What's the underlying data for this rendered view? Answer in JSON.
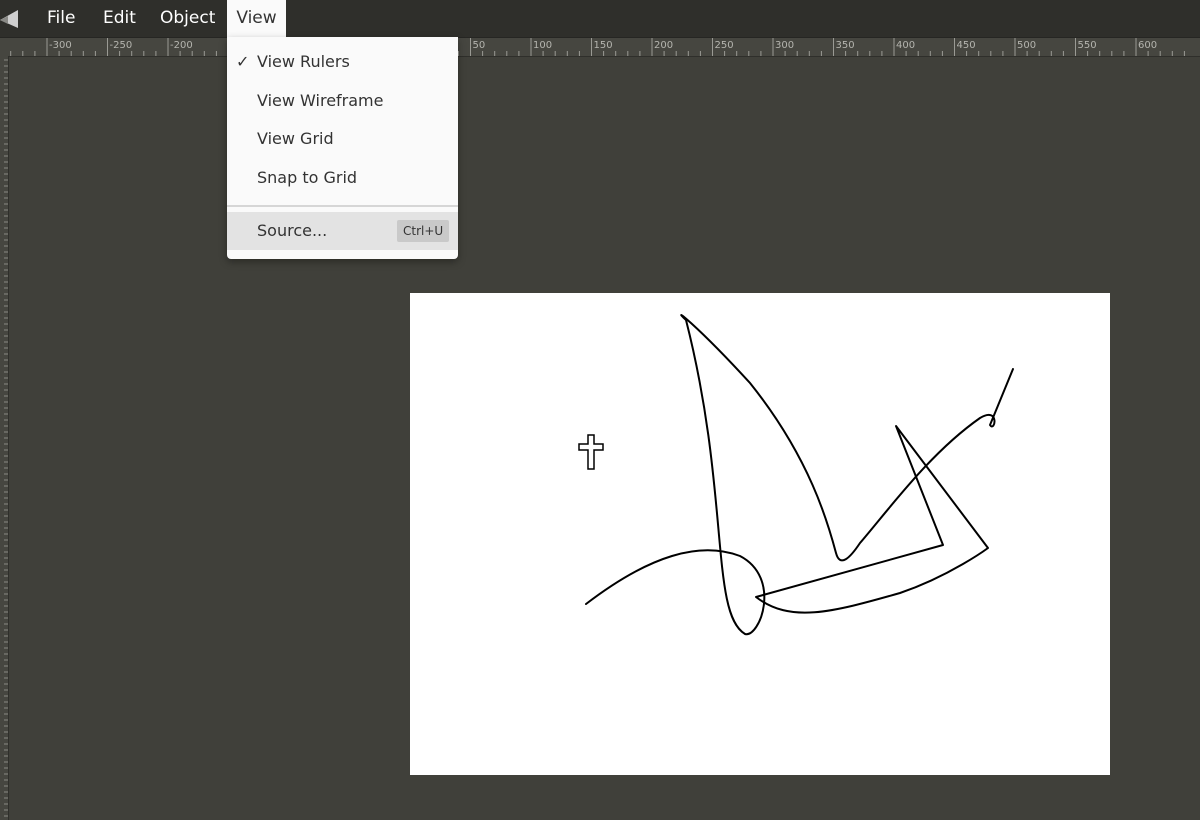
{
  "menubar": {
    "file": "File",
    "edit": "Edit",
    "object": "Object",
    "view": "View"
  },
  "view_menu": {
    "items": [
      {
        "label": "View Rulers",
        "checked": true
      },
      {
        "label": "View Wireframe",
        "checked": false
      },
      {
        "label": "View Grid",
        "checked": false
      },
      {
        "label": "Snap to Grid",
        "checked": false
      }
    ],
    "source": {
      "label": "Source...",
      "shortcut": "Ctrl+U"
    },
    "check_glyph": "✓"
  },
  "ruler": {
    "labels": [
      "-300",
      "-250",
      "-200",
      "50",
      "100",
      "150",
      "200",
      "250",
      "300",
      "350",
      "400",
      "450",
      "500",
      "550",
      "600"
    ]
  },
  "colors": {
    "background": "#40403a",
    "menubar": "#2f2f2b",
    "menu_panel": "#fafafa",
    "canvas": "#ffffff",
    "stroke": "#000000"
  },
  "icons": {
    "logo": "editor-logo-icon",
    "cursor": "crosshair-cursor-icon"
  }
}
